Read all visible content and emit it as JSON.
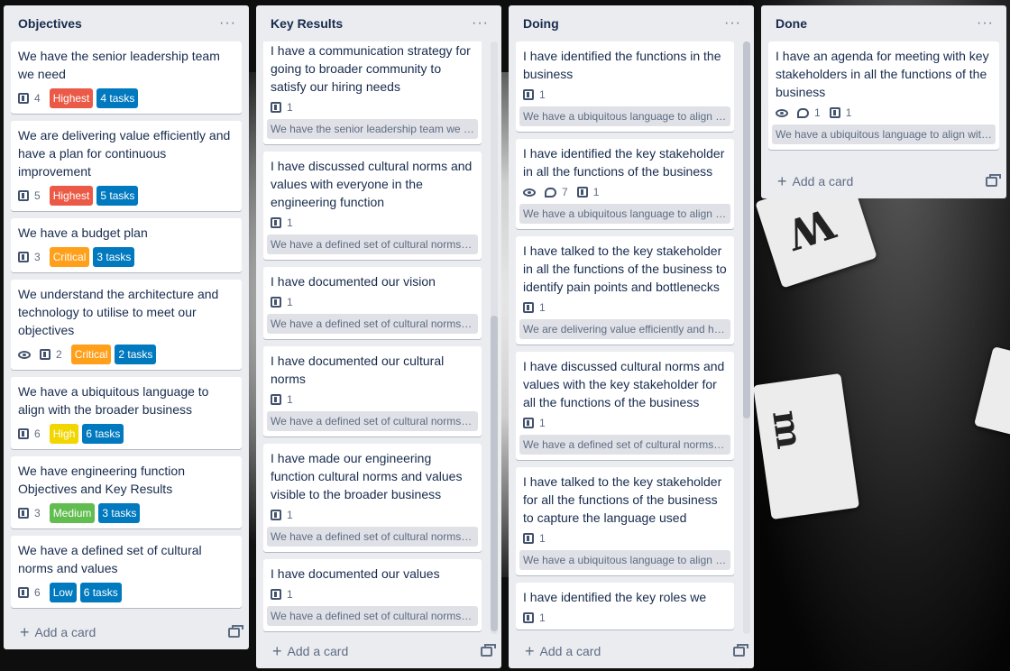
{
  "lists": [
    {
      "title": "Objectives",
      "menu": "···",
      "add_card": "Add a card",
      "cards": [
        {
          "title": "We have the senior leadership team we need",
          "boards": "4",
          "labels": [
            {
              "text": "Highest",
              "color": "red"
            },
            {
              "text": "4 tasks",
              "color": "blue"
            }
          ]
        },
        {
          "title": "We are delivering value efficiently and have a plan for continuous improvement",
          "boards": "5",
          "labels": [
            {
              "text": "Highest",
              "color": "red"
            },
            {
              "text": "5 tasks",
              "color": "blue"
            }
          ]
        },
        {
          "title": "We have a budget plan",
          "boards": "3",
          "labels": [
            {
              "text": "Critical",
              "color": "orange"
            },
            {
              "text": "3 tasks",
              "color": "blue"
            }
          ]
        },
        {
          "title": "We understand the architecture and technology to utilise to meet our objectives",
          "watch": true,
          "boards": "2",
          "labels": [
            {
              "text": "Critical",
              "color": "orange"
            },
            {
              "text": "2 tasks",
              "color": "blue"
            }
          ]
        },
        {
          "title": "We have a ubiquitous language to align with the broader business",
          "boards": "6",
          "labels": [
            {
              "text": "High",
              "color": "yellow"
            },
            {
              "text": "6 tasks",
              "color": "blue"
            }
          ]
        },
        {
          "title": "We have engineering function Objectives and Key Results",
          "boards": "3",
          "labels": [
            {
              "text": "Medium",
              "color": "green"
            },
            {
              "text": "3 tasks",
              "color": "blue"
            }
          ]
        },
        {
          "title": "We have a defined set of cultural norms and values",
          "boards": "6",
          "labels": [
            {
              "text": "Low",
              "color": "blue"
            },
            {
              "text": "6 tasks",
              "color": "blue"
            }
          ]
        }
      ]
    },
    {
      "title": "Key Results",
      "menu": "···",
      "add_card": "Add a card",
      "cards": [
        {
          "title": "I have a communication strategy for going to broader community to satisfy our hiring needs",
          "boards": "1",
          "attachment": "We have the senior leadership team we need"
        },
        {
          "title": "I have discussed cultural norms and values with everyone in the engineering function",
          "boards": "1",
          "attachment": "We have a defined set of cultural norms and values"
        },
        {
          "title": "I have documented our vision",
          "boards": "1",
          "attachment": "We have a defined set of cultural norms and values"
        },
        {
          "title": "I have documented our cultural norms",
          "boards": "1",
          "attachment": "We have a defined set of cultural norms and values"
        },
        {
          "title": "I have made our engineering function cultural norms and values visible to the broader business",
          "boards": "1",
          "attachment": "We have a defined set of cultural norms and values"
        },
        {
          "title": "I have documented our values",
          "boards": "1",
          "attachment": "We have a defined set of cultural norms and values"
        }
      ]
    },
    {
      "title": "Doing",
      "menu": "···",
      "add_card": "Add a card",
      "cards": [
        {
          "title": "I have identified the functions in the business",
          "boards": "1",
          "attachment": "We have a ubiquitous language to align with the broader business"
        },
        {
          "title": "I have identified the key stakeholder in all the functions of the business",
          "watch": true,
          "comments": "7",
          "boards": "1",
          "attachment": "We have a ubiquitous language to align with the broader business"
        },
        {
          "title": "I have talked to the key stakeholder in all the functions of the business to identify pain points and bottlenecks",
          "boards": "1",
          "attachment": "We are delivering value efficiently and have a plan for continuous improvement"
        },
        {
          "title": "I have discussed cultural norms and values with the key stakeholder for all the functions of the business",
          "boards": "1",
          "attachment": "We have a defined set of cultural norms and values"
        },
        {
          "title": "I have talked to the key stakeholder for all the functions of the business to capture the language used",
          "boards": "1",
          "attachment": "We have a ubiquitous language to align with the broader business"
        },
        {
          "title": "I have identified the key roles we",
          "boards": "1",
          "attachment": ""
        }
      ]
    },
    {
      "title": "Done",
      "menu": "···",
      "add_card": "Add a card",
      "cards": [
        {
          "title": "I have an agenda for meeting with key stakeholders in all the functions of the business",
          "watch": true,
          "comments": "1",
          "boards": "1",
          "attachment": "We have a ubiquitous language to align with the broader business"
        }
      ]
    }
  ],
  "colors": {
    "red": "#eb5a46",
    "orange": "#ff9f1a",
    "yellow": "#f2d600",
    "green": "#61bd4f",
    "blue": "#0079bf",
    "list_bg": "#ebecf0"
  }
}
